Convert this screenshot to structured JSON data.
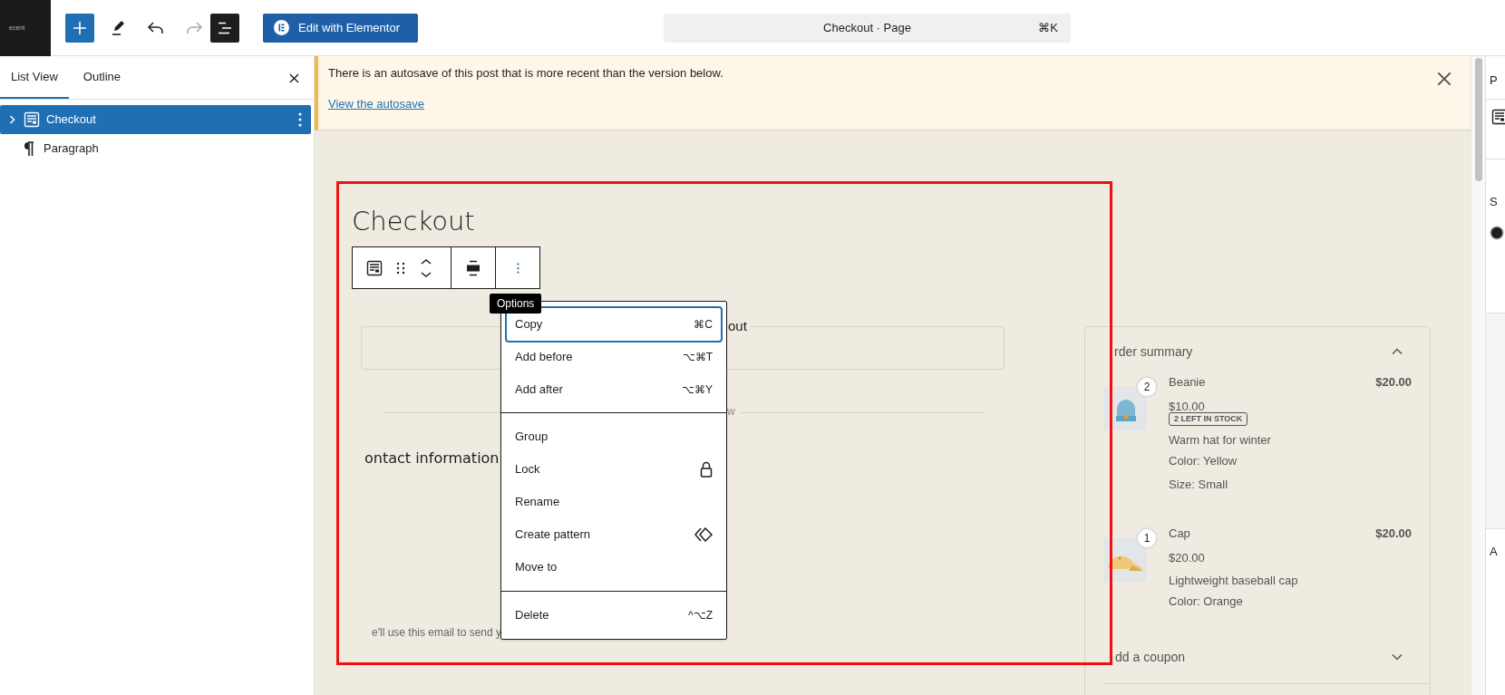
{
  "top_bar": {
    "site_logo": "ecent",
    "tools": [
      {
        "kind": "inserter",
        "pressed": false
      },
      {
        "kind": "tools",
        "pressed": false
      },
      {
        "kind": "undo",
        "disabled": false
      },
      {
        "kind": "redo",
        "disabled": true
      },
      {
        "kind": "list_view",
        "pressed": true
      }
    ],
    "edit_button": "Edit with Elementor",
    "command_bar": {
      "title": "Checkout · Page",
      "shortcut": "⌘K"
    }
  },
  "list_view": {
    "tabs": [
      {
        "label": "List View",
        "selected": true
      },
      {
        "label": "Outline",
        "selected": false
      }
    ],
    "items": [
      {
        "label": "Checkout",
        "kind": "form",
        "selected": true,
        "expanded": false
      },
      {
        "label": "Paragraph",
        "kind": "paragraph",
        "selected": false
      }
    ]
  },
  "notice": {
    "message": "There is an autosave of this post that is more recent than the version below.",
    "link": "View the autosave"
  },
  "canvas": {
    "title": "Checkout",
    "express_legend": "out",
    "divider_text": "w",
    "contact_heading": "ontact information",
    "email_note": "e'll use this email to send y",
    "tooltip": "Options",
    "menu": {
      "groups": [
        [
          {
            "label": "Copy",
            "kind": "shortcut",
            "shortcut": "⌘C",
            "selected": true
          },
          {
            "label": "Add before",
            "kind": "shortcut",
            "shortcut": "⌥⌘T",
            "selected": false
          },
          {
            "label": "Add after",
            "kind": "shortcut",
            "shortcut": "⌥⌘Y",
            "selected": false
          }
        ],
        [
          {
            "label": "Group",
            "kind": "plain",
            "selected": false
          },
          {
            "label": "Lock",
            "kind": "lock",
            "selected": false
          },
          {
            "label": "Rename",
            "kind": "plain",
            "selected": false
          },
          {
            "label": "Create pattern",
            "kind": "pattern",
            "selected": false
          },
          {
            "label": "Move to",
            "kind": "plain",
            "selected": false
          }
        ],
        [
          {
            "label": "Delete",
            "kind": "shortcut",
            "shortcut": "^⌥Z",
            "selected": false
          }
        ]
      ]
    }
  },
  "order_summary": {
    "title": "rder summary",
    "expanded": true,
    "items": [
      {
        "kind": "beanie",
        "quantity": "2",
        "name": "Beanie",
        "total": "$20.00",
        "price": "$10.00",
        "stock": "2 LEFT IN STOCK",
        "description": "Warm hat for winter",
        "details": [
          "Color: Yellow",
          "Size: Small"
        ]
      },
      {
        "kind": "cap",
        "quantity": "1",
        "name": "Cap",
        "total": "$20.00",
        "price": "$20.00",
        "description": "Lightweight baseball cap",
        "details": [
          "Color: Orange"
        ]
      }
    ],
    "coupon": {
      "label": "dd a coupon",
      "expanded": false
    }
  },
  "settings_sidebar": {
    "sections": [
      {
        "label": "P"
      },
      {
        "label": "S"
      },
      {
        "label": "A"
      }
    ]
  }
}
